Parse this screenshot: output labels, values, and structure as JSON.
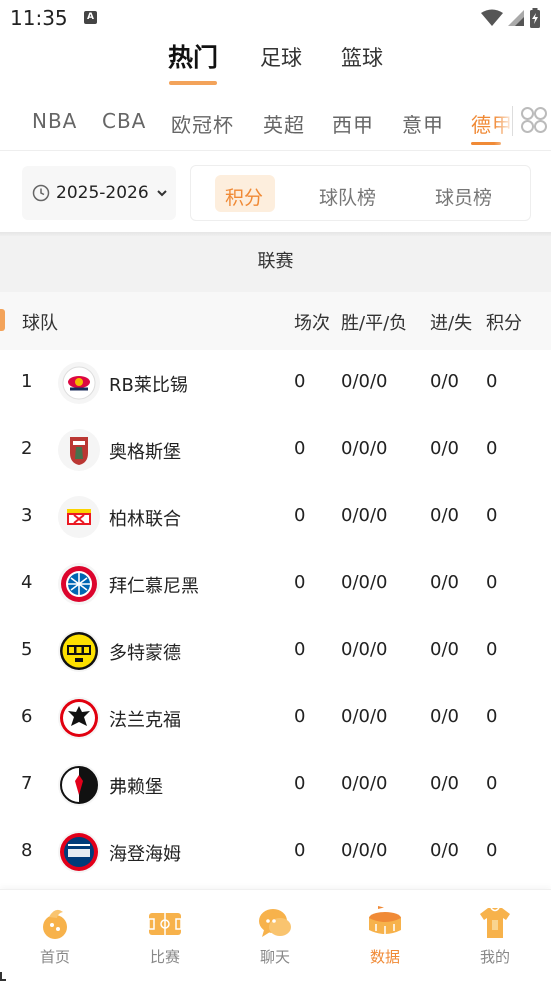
{
  "status_bar": {
    "time": "11:35",
    "notification_icon": "A"
  },
  "top_tabs": [
    {
      "label": "热门",
      "active": true
    },
    {
      "label": "足球",
      "active": false
    },
    {
      "label": "篮球",
      "active": false
    }
  ],
  "league_tabs": [
    {
      "label": "NBA",
      "active": false
    },
    {
      "label": "CBA",
      "active": false
    },
    {
      "label": "欧冠杯",
      "active": false
    },
    {
      "label": "英超",
      "active": false
    },
    {
      "label": "西甲",
      "active": false
    },
    {
      "label": "意甲",
      "active": false
    },
    {
      "label": "德甲",
      "active": true
    }
  ],
  "season": {
    "label": "2025-2026"
  },
  "segments": [
    {
      "label": "积分",
      "active": true
    },
    {
      "label": "球队榜",
      "active": false
    },
    {
      "label": "球员榜",
      "active": false
    }
  ],
  "section_title": "联赛",
  "table": {
    "headers": {
      "team": "球队",
      "played": "场次",
      "wdl": "胜/平/负",
      "gd": "进/失",
      "pts": "积分"
    },
    "rows": [
      {
        "rank": "1",
        "team": "RB莱比锡",
        "played": "0",
        "wdl": "0/0/0",
        "gd": "0/0",
        "pts": "0",
        "logo_icon": "rb-leipzig-logo-icon"
      },
      {
        "rank": "2",
        "team": "奥格斯堡",
        "played": "0",
        "wdl": "0/0/0",
        "gd": "0/0",
        "pts": "0",
        "logo_icon": "augsburg-logo-icon"
      },
      {
        "rank": "3",
        "team": "柏林联合",
        "played": "0",
        "wdl": "0/0/0",
        "gd": "0/0",
        "pts": "0",
        "logo_icon": "union-berlin-logo-icon"
      },
      {
        "rank": "4",
        "team": "拜仁慕尼黑",
        "played": "0",
        "wdl": "0/0/0",
        "gd": "0/0",
        "pts": "0",
        "logo_icon": "bayern-logo-icon"
      },
      {
        "rank": "5",
        "team": "多特蒙德",
        "played": "0",
        "wdl": "0/0/0",
        "gd": "0/0",
        "pts": "0",
        "logo_icon": "dortmund-logo-icon"
      },
      {
        "rank": "6",
        "team": "法兰克福",
        "played": "0",
        "wdl": "0/0/0",
        "gd": "0/0",
        "pts": "0",
        "logo_icon": "frankfurt-logo-icon"
      },
      {
        "rank": "7",
        "team": "弗赖堡",
        "played": "0",
        "wdl": "0/0/0",
        "gd": "0/0",
        "pts": "0",
        "logo_icon": "freiburg-logo-icon"
      },
      {
        "rank": "8",
        "team": "海登海姆",
        "played": "0",
        "wdl": "0/0/0",
        "gd": "0/0",
        "pts": "0",
        "logo_icon": "heidenheim-logo-icon"
      }
    ]
  },
  "bottom_nav": [
    {
      "label": "首页",
      "icon": "home-icon",
      "active": false
    },
    {
      "label": "比赛",
      "icon": "match-field-icon",
      "active": false
    },
    {
      "label": "聊天",
      "icon": "chat-bubble-icon",
      "active": false
    },
    {
      "label": "数据",
      "icon": "data-stadium-icon",
      "active": true
    },
    {
      "label": "我的",
      "icon": "profile-jersey-icon",
      "active": false
    }
  ],
  "colors": {
    "accent": "#f08a36",
    "accent_light": "#f3a35a",
    "segment_bg": "#fdeedd"
  }
}
